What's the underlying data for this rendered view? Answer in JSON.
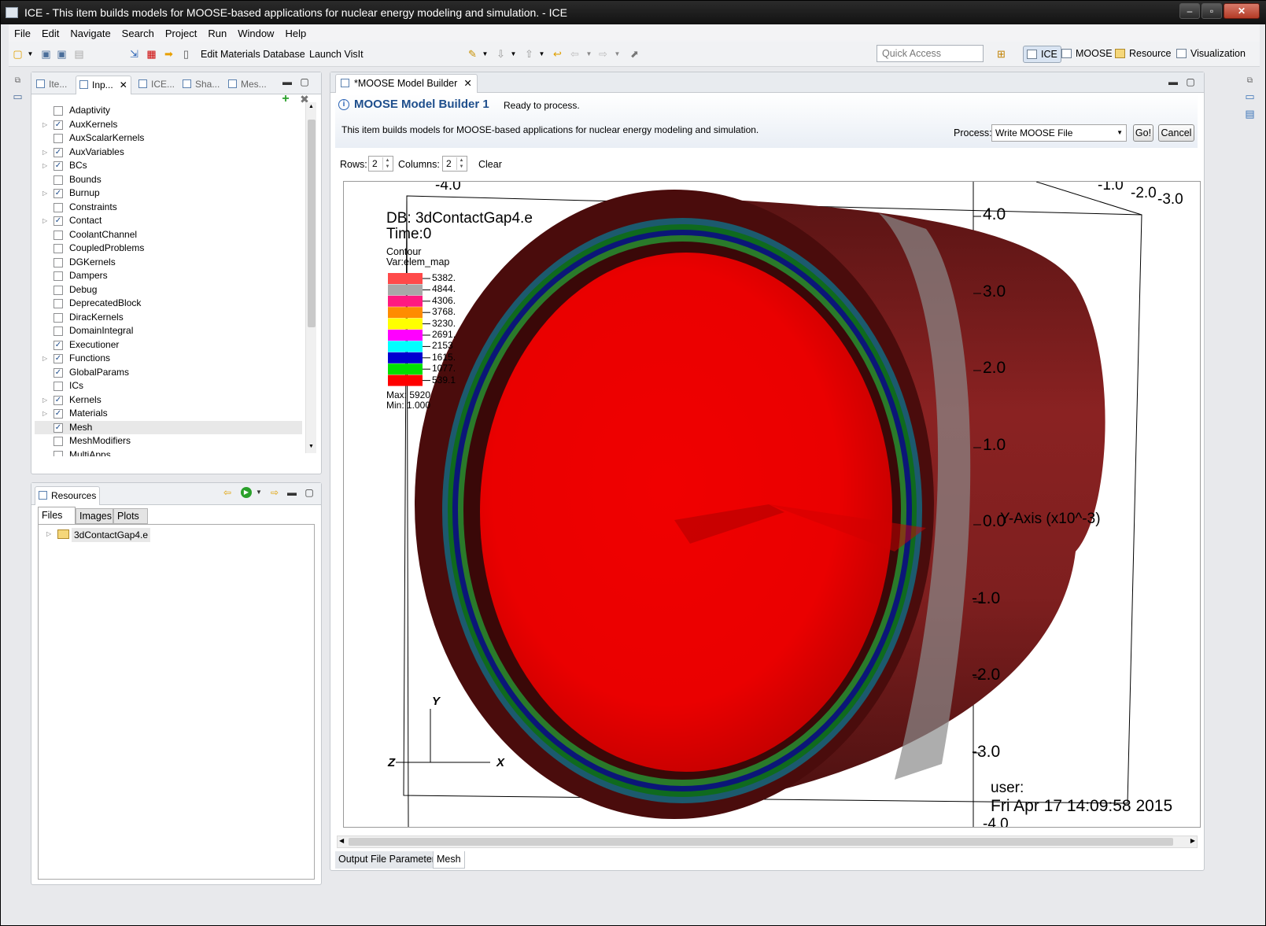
{
  "window": {
    "title": "ICE - This item builds models for MOOSE-based applications for nuclear energy modeling and simulation. - ICE"
  },
  "menu": [
    "File",
    "Edit",
    "Navigate",
    "Search",
    "Project",
    "Run",
    "Window",
    "Help"
  ],
  "toolbar": {
    "edit_materials": "Edit Materials Database",
    "launch_visit": "Launch VisIt",
    "quick_access_placeholder": "Quick Access",
    "perspectives": [
      "ICE",
      "MOOSE",
      "Resource",
      "Visualization"
    ]
  },
  "left_top_panel": {
    "tabs": [
      "Ite...",
      "Inp...",
      "ICE...",
      "Sha...",
      "Mes..."
    ],
    "tree": [
      {
        "label": "Adaptivity",
        "checked": false,
        "expandable": false
      },
      {
        "label": "AuxKernels",
        "checked": true,
        "expandable": true
      },
      {
        "label": "AuxScalarKernels",
        "checked": false,
        "expandable": false
      },
      {
        "label": "AuxVariables",
        "checked": true,
        "expandable": true
      },
      {
        "label": "BCs",
        "checked": true,
        "expandable": true
      },
      {
        "label": "Bounds",
        "checked": false,
        "expandable": false
      },
      {
        "label": "Burnup",
        "checked": true,
        "expandable": true
      },
      {
        "label": "Constraints",
        "checked": false,
        "expandable": false
      },
      {
        "label": "Contact",
        "checked": true,
        "expandable": true
      },
      {
        "label": "CoolantChannel",
        "checked": false,
        "expandable": false
      },
      {
        "label": "CoupledProblems",
        "checked": false,
        "expandable": false
      },
      {
        "label": "DGKernels",
        "checked": false,
        "expandable": false
      },
      {
        "label": "Dampers",
        "checked": false,
        "expandable": false
      },
      {
        "label": "Debug",
        "checked": false,
        "expandable": false
      },
      {
        "label": "DeprecatedBlock",
        "checked": false,
        "expandable": false
      },
      {
        "label": "DiracKernels",
        "checked": false,
        "expandable": false
      },
      {
        "label": "DomainIntegral",
        "checked": false,
        "expandable": false
      },
      {
        "label": "Executioner",
        "checked": true,
        "expandable": false
      },
      {
        "label": "Functions",
        "checked": true,
        "expandable": true
      },
      {
        "label": "GlobalParams",
        "checked": true,
        "expandable": false
      },
      {
        "label": "ICs",
        "checked": false,
        "expandable": false
      },
      {
        "label": "Kernels",
        "checked": true,
        "expandable": true
      },
      {
        "label": "Materials",
        "checked": true,
        "expandable": true
      },
      {
        "label": "Mesh",
        "checked": true,
        "expandable": false,
        "selected": true
      },
      {
        "label": "MeshModifiers",
        "checked": false,
        "expandable": false
      },
      {
        "label": "MultiApps",
        "checked": false,
        "expandable": false
      }
    ]
  },
  "resources_panel": {
    "title": "Resources",
    "tabs": [
      "Files",
      "Images",
      "Plots"
    ],
    "files": [
      {
        "label": "3dContactGap4.e"
      }
    ]
  },
  "editor": {
    "tab_label": "*MOOSE Model Builder",
    "form_title": "MOOSE Model Builder 1",
    "status": "Ready to process.",
    "description": "This item builds models for MOOSE-based applications for nuclear energy modeling and simulation.",
    "process_label": "Process:",
    "process_value": "Write MOOSE File",
    "go_label": "Go!",
    "cancel_label": "Cancel",
    "rows_label": "Rows:",
    "rows_value": "2",
    "columns_label": "Columns:",
    "columns_value": "2",
    "clear_label": "Clear",
    "bottom_tabs": [
      "Output File Parameters",
      "Mesh"
    ]
  },
  "visualization": {
    "db": "DB: 3dContactGap4.e",
    "time": "Time:0",
    "legend_title": "Contour",
    "legend_var": "Var:elem_map",
    "legend": [
      {
        "color": "#ff4a4a",
        "label": "5382."
      },
      {
        "color": "#a8a8a8",
        "label": "4844."
      },
      {
        "color": "#ff1a80",
        "label": "4306."
      },
      {
        "color": "#ff8c00",
        "label": "3768."
      },
      {
        "color": "#ffff00",
        "label": "3230."
      },
      {
        "color": "#ff00ff",
        "label": "2691."
      },
      {
        "color": "#00ffff",
        "label": "2153"
      },
      {
        "color": "#0000d0",
        "label": "1615."
      },
      {
        "color": "#00e000",
        "label": "1077."
      },
      {
        "color": "#ff0000",
        "label": "539.1"
      }
    ],
    "max": "Max: 5920",
    "min": "Min: 1.000",
    "axis_ticks": [
      "4.0",
      "3.0",
      "2.0",
      "1.0",
      "0.0",
      "-1.0",
      "-2.0",
      "-3.0"
    ],
    "top_ticks_left": "-4.0",
    "top_ticks_right": [
      "-1.0",
      "-2.0",
      "-3.0"
    ],
    "y_axis_label": "Y-Axis (x10^-3)",
    "triad": {
      "y": "Y",
      "z": "Z",
      "x": "X"
    },
    "user": "user:",
    "timestamp": "Fri Apr 17 14:09:58 2015",
    "bottom_tick": "-4.0"
  }
}
